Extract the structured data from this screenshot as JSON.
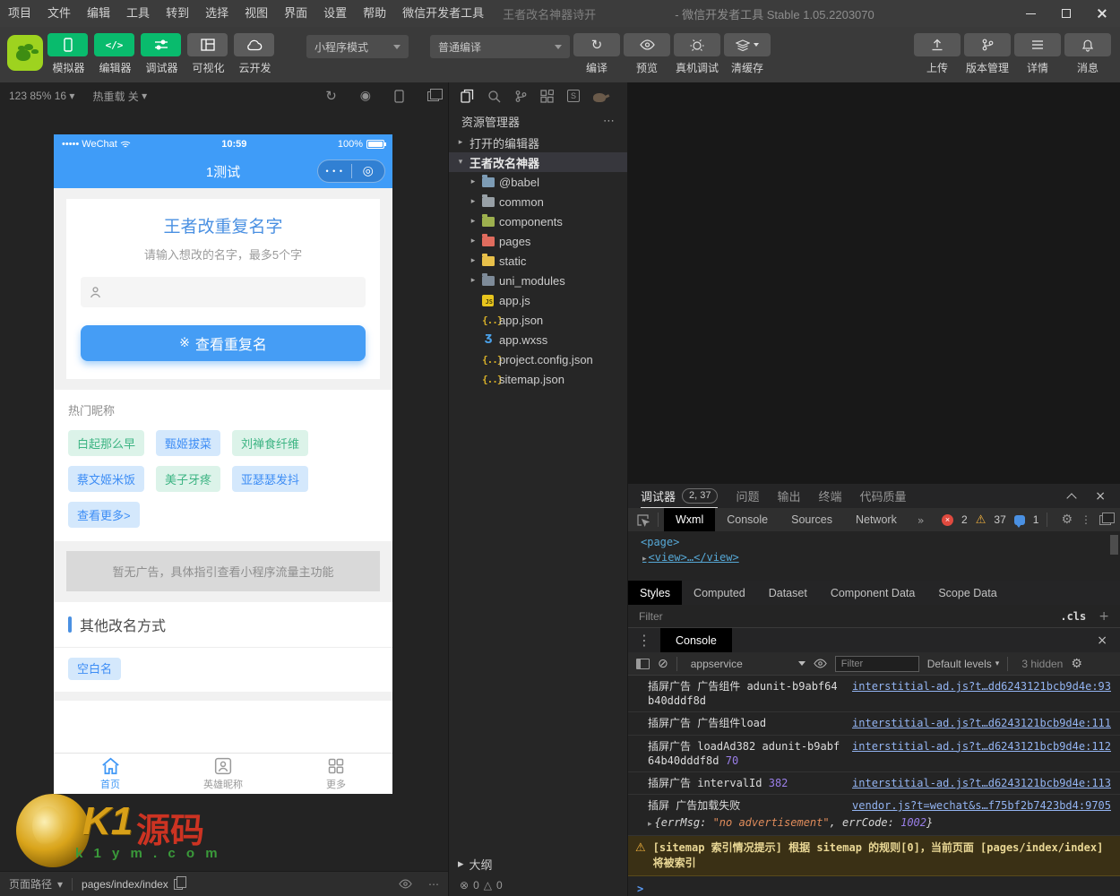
{
  "window": {
    "menu": [
      "项目",
      "文件",
      "编辑",
      "工具",
      "转到",
      "选择",
      "视图",
      "界面",
      "设置",
      "帮助",
      "微信开发者工具"
    ],
    "doc_title": "王者改名神器诗开",
    "app_title": "- 微信开发者工具 Stable 1.05.2203070"
  },
  "toolbar": {
    "nav_buttons": [
      {
        "label": "模拟器"
      },
      {
        "label": "编辑器"
      },
      {
        "label": "调试器"
      },
      {
        "label": "可视化"
      },
      {
        "label": "云开发"
      }
    ],
    "mode_select": "小程序模式",
    "compile_select": "普通编译",
    "compile_actions": [
      {
        "label": "编译"
      },
      {
        "label": "预览"
      },
      {
        "label": "真机调试"
      },
      {
        "label": "清缓存"
      }
    ],
    "right_actions": [
      {
        "label": "上传"
      },
      {
        "label": "版本管理"
      },
      {
        "label": "详情"
      },
      {
        "label": "消息"
      }
    ]
  },
  "simulator": {
    "device_info": "123 85% 16",
    "hot_reload": "热重载 关",
    "bottom": {
      "path_label": "页面路径",
      "path": "pages/index/index"
    }
  },
  "phone": {
    "status": {
      "carrier": "••••• WeChat",
      "time": "10:59",
      "battery": "100%"
    },
    "nav_title": "1测试",
    "home": {
      "title": "王者改重复名字",
      "subtitle": "请输入想改的名字，最多5个字",
      "cta": "查看重复名",
      "hot_title": "热门昵称",
      "tags": [
        {
          "label": "白起那么早",
          "color": "green"
        },
        {
          "label": "甄姬拔菜",
          "color": "blue"
        },
        {
          "label": "刘禅食纤维",
          "color": "green"
        },
        {
          "label": "蔡文姬米饭",
          "color": "blue"
        },
        {
          "label": "美子牙疼",
          "color": "green"
        },
        {
          "label": "亚瑟瑟发抖",
          "color": "blue"
        },
        {
          "label": "查看更多>",
          "color": "blue"
        }
      ],
      "ad_placeholder": "暂无广告，具体指引查看小程序流量主功能",
      "other_title": "其他改名方式",
      "blank_tag": "空白名"
    },
    "tabbar": [
      {
        "label": "首页",
        "active": true
      },
      {
        "label": "英雄昵称",
        "active": false
      },
      {
        "label": "更多",
        "active": false
      }
    ]
  },
  "watermark": {
    "big": "K1",
    "cn": "源码",
    "site_spaced": "k 1 y m . c o m"
  },
  "explorer": {
    "title": "资源管理器",
    "open_editors": "打开的编辑器",
    "project": "王者改名神器",
    "items": [
      {
        "name": "@babel",
        "kind": "folder"
      },
      {
        "name": "common",
        "kind": "folder"
      },
      {
        "name": "components",
        "kind": "folder"
      },
      {
        "name": "pages",
        "kind": "folder"
      },
      {
        "name": "static",
        "kind": "folder"
      },
      {
        "name": "uni_modules",
        "kind": "folder"
      },
      {
        "name": "app.js",
        "kind": "js"
      },
      {
        "name": "app.json",
        "kind": "json"
      },
      {
        "name": "app.wxss",
        "kind": "wxss"
      },
      {
        "name": "project.config.json",
        "kind": "json"
      },
      {
        "name": "sitemap.json",
        "kind": "json"
      }
    ],
    "outline": "大纲",
    "problems": {
      "errors": "0",
      "warnings": "0"
    }
  },
  "debugger": {
    "tabs": [
      {
        "label": "调试器",
        "badge": "2, 37",
        "active": true
      },
      {
        "label": "问题"
      },
      {
        "label": "输出"
      },
      {
        "label": "终端"
      },
      {
        "label": "代码质量"
      }
    ],
    "devtools_tabs": [
      "Wxml",
      "Console",
      "Sources",
      "Network"
    ],
    "counts": {
      "errors": "2",
      "warnings": "37",
      "info": "1"
    },
    "wxml": {
      "line1": "<page>",
      "line2": "<view>…</view>"
    },
    "style_tabs": [
      "Styles",
      "Computed",
      "Dataset",
      "Component Data",
      "Scope Data"
    ],
    "style_filter": "Filter",
    "cls": ".cls",
    "console": {
      "tab": "Console",
      "context": "appservice",
      "filter_placeholder": "Filter",
      "levels": "Default levels",
      "hidden": "3 hidden",
      "logs": [
        {
          "text": "插屏广告 广告组件 adunit-b9abf64b40dddf8d",
          "link": "interstitial-ad.js?t…dd6243121bcb9d4e:93"
        },
        {
          "text": "插屏广告 广告组件load",
          "link": "interstitial-ad.js?t…d6243121bcb9d4e:111"
        },
        {
          "text": "插屏广告 loadAd382 adunit-b9abf64b40dddf8d",
          "value": "70",
          "link": "interstitial-ad.js?t…d6243121bcb9d4e:112"
        },
        {
          "text": "插屏广告 intervalId",
          "value": "382",
          "link": "interstitial-ad.js?t…d6243121bcb9d4e:113"
        },
        {
          "text": "插屏 广告加载失败",
          "link": "vendor.js?t=wechat&s…f75bf2b7423bd4:9705"
        }
      ],
      "expand": {
        "prefix": "{errMsg: ",
        "str": "\"no advertisement\"",
        "mid": ", errCode: ",
        "num": "1002",
        "suffix": "}"
      },
      "warning": "[sitemap 索引情况提示] 根据 sitemap 的规则[0]，当前页面 [pages/index/index] 将被索引",
      "prompt": ">"
    }
  },
  "icons": {
    "caret_right": "▸",
    "caret_down": "▾",
    "ellipsis": "⋯",
    "v_dots": "⋮",
    "sparkle": "※",
    "record": "◉",
    "refresh": "↻",
    "target": "◎",
    "dots3": "• • •",
    "gear": "⚙",
    "warning": "⚠",
    "error_circle": "⊗",
    "triangle": "△",
    "chevron_more": "»",
    "plus": "+",
    "close": "×",
    "braces": "{..}",
    "wxss": "Ʒ",
    "js": "JS",
    "s": "S",
    "clear": "⊘",
    "code": "</>"
  },
  "colors": {
    "wechat_green": "#09bb6d",
    "phone_blue": "#3f9cf8",
    "button_blue": "#459df5",
    "tag_green": "#3db483",
    "tag_blue": "#3d8df5",
    "link_blue": "#93b4f2",
    "warn_yellow": "#f2b13d",
    "error_red": "#e04a3f"
  }
}
